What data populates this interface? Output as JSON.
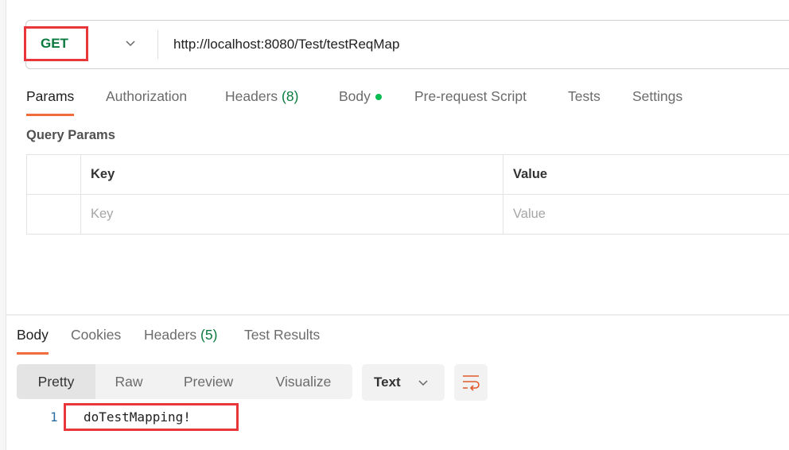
{
  "request": {
    "method": "GET",
    "url": "http://localhost:8080/Test/testReqMap"
  },
  "request_tabs": [
    {
      "label": "Params",
      "active": true
    },
    {
      "label": "Authorization"
    },
    {
      "label": "Headers",
      "count": "(8)"
    },
    {
      "label": "Body",
      "indicator": "green-dot"
    },
    {
      "label": "Pre-request Script"
    },
    {
      "label": "Tests"
    },
    {
      "label": "Settings"
    }
  ],
  "query_params": {
    "title": "Query Params",
    "columns": [
      "Key",
      "Value"
    ],
    "placeholders": [
      "Key",
      "Value"
    ]
  },
  "response_tabs": [
    {
      "label": "Body",
      "active": true
    },
    {
      "label": "Cookies"
    },
    {
      "label": "Headers",
      "count": "(5)"
    },
    {
      "label": "Test Results"
    }
  ],
  "view_modes": [
    "Pretty",
    "Raw",
    "Preview",
    "Visualize"
  ],
  "format": "Text",
  "response_body": {
    "line": "1",
    "text": "doTestMapping!"
  },
  "colors": {
    "accent": "#f26b3a",
    "method": "#0a7a3e",
    "highlight": "#e8363b"
  }
}
